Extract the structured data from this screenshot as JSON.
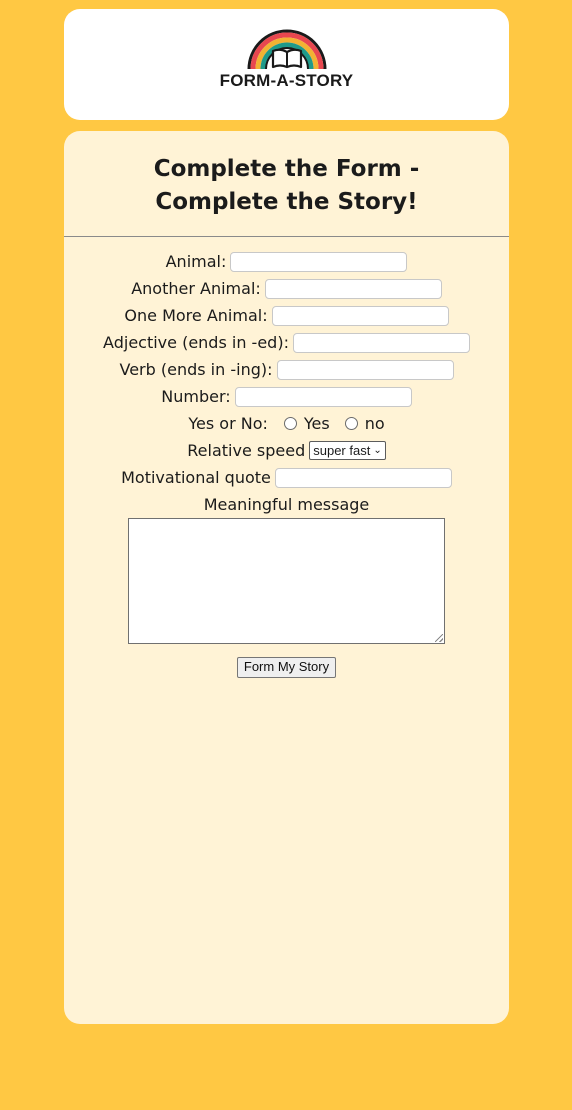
{
  "header": {
    "logo_text": "FORM-A-STORY",
    "rainbow_colors": [
      "#e8474f",
      "#f2b233",
      "#1f9a8a",
      "#1a1a1a"
    ]
  },
  "form": {
    "title_line1": "Complete the Form -",
    "title_line2": "Complete the Story!",
    "fields": {
      "animal": "Animal:",
      "another_animal": "Another Animal:",
      "one_more_animal": "One More Animal:",
      "adjective": "Adjective (ends in -ed):",
      "verb": "Verb (ends in -ing):",
      "number": "Number:",
      "yes_or_no": "Yes or No:",
      "relative_speed": "Relative speed",
      "motivational_quote": "Motivational quote",
      "meaningful_message": "Meaningful message"
    },
    "radio_options": {
      "yes": "Yes",
      "no": "no"
    },
    "speed_selected": "super fast",
    "submit_label": "Form My Story"
  },
  "colors": {
    "page_background": "#ffc843",
    "form_card_background": "#fff3d6",
    "header_card_background": "#ffffff"
  }
}
